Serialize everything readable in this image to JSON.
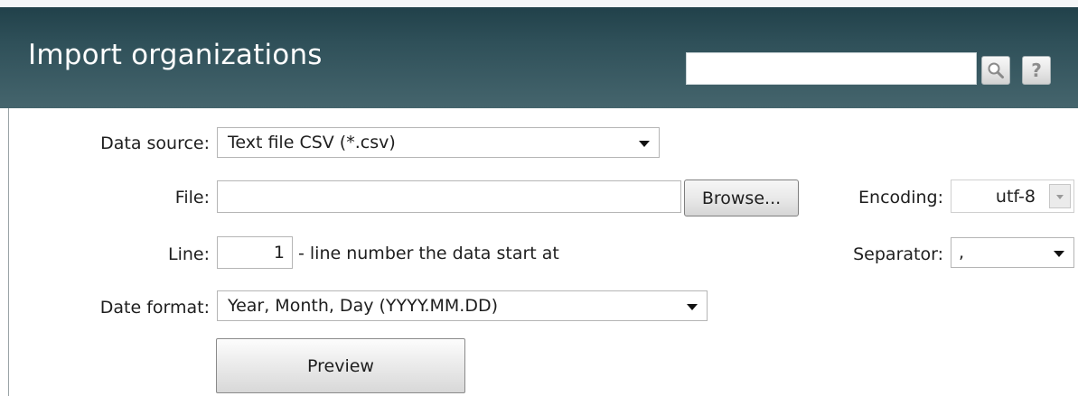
{
  "header": {
    "title": "Import organizations",
    "search_value": "",
    "search_icon": "search-icon",
    "help_icon": "help-icon",
    "help_glyph": "?"
  },
  "form": {
    "data_source": {
      "label": "Data source:",
      "value": "Text file CSV (*.csv)"
    },
    "file": {
      "label": "File:",
      "value": "",
      "browse_label": "Browse..."
    },
    "encoding": {
      "label": "Encoding:",
      "value": "utf-8"
    },
    "line": {
      "label": "Line:",
      "value": "1",
      "hint": "- line number the data start at"
    },
    "separator": {
      "label": "Separator:",
      "value": ","
    },
    "date_format": {
      "label": "Date format:",
      "value": "Year, Month, Day (YYYY.MM.DD)"
    },
    "preview_label": "Preview"
  },
  "colors": {
    "header_dark": "#21414a",
    "header_light": "#45656d",
    "header_text": "#ffffff"
  }
}
